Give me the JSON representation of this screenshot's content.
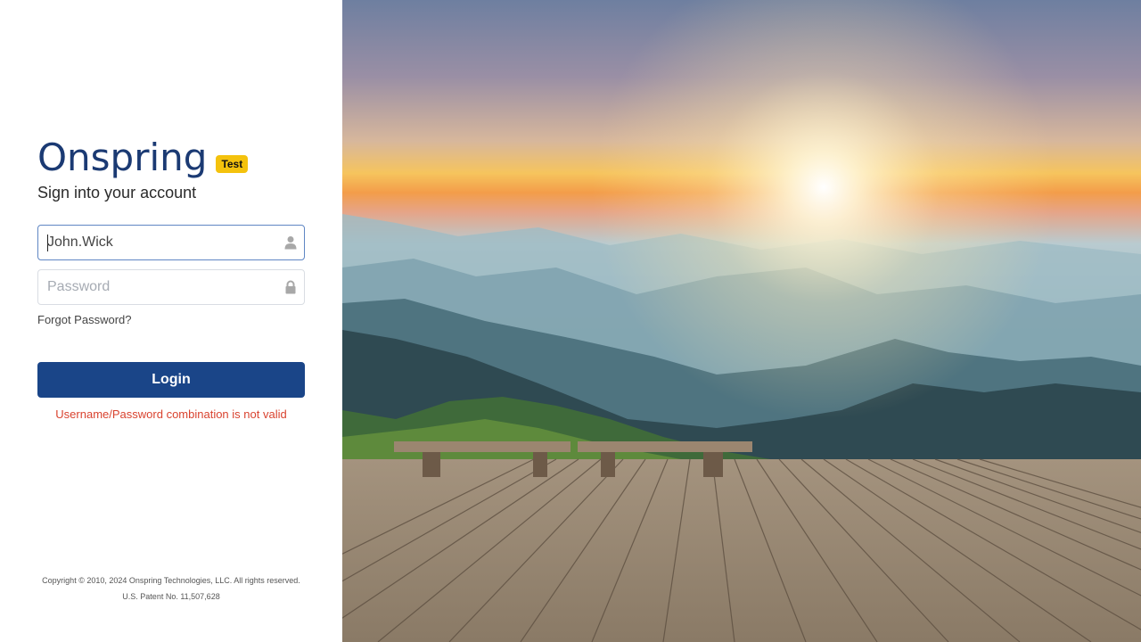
{
  "brand": {
    "name": "Onspring",
    "env_badge": "Test",
    "primary_color": "#1b3a73",
    "accent_color": "#f29a21",
    "badge_color": "#f4c20d"
  },
  "login": {
    "title": "Sign into your account",
    "username_value": "John.Wick",
    "username_icon": "user-icon",
    "password_placeholder": "Password",
    "password_icon": "lock-icon",
    "forgot_password": "Forgot Password?",
    "login_button": "Login",
    "button_color": "#1a4588",
    "error_message": "Username/Password combination is not valid",
    "error_color": "#d9432f"
  },
  "footer": {
    "copyright": "Copyright © 2010, 2024 Onspring Technologies, LLC. All rights reserved.",
    "patent": "U.S. Patent No. 11,507,628"
  },
  "background": {
    "description_icon": "landscape-image"
  }
}
